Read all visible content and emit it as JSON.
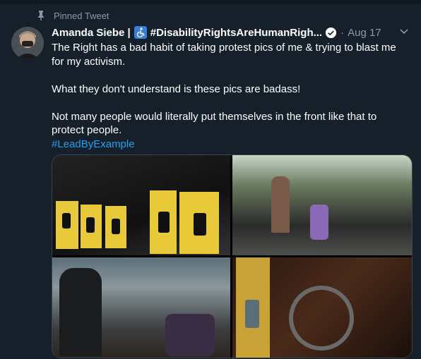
{
  "pinned": {
    "label": "Pinned Tweet"
  },
  "author": {
    "display_name": "Amanda Siebe |",
    "name_hashtag": "#DisabilityRightsAreHumanRigh...",
    "date": "Aug 17"
  },
  "tweet": {
    "line1": "The Right has a bad habit of taking protest pics of me & trying to blast me for my activism.",
    "line2": "What they don't understand is these pics are badass!",
    "line3": "Not many people would literally put themselves in the front like that to protect people.",
    "hashtag": "#LeadByExample"
  },
  "icons": {
    "pin": "pin-icon",
    "accessibility": "wheelchair-icon",
    "verified": "verified-badge-icon",
    "menu": "chevron-down-icon"
  },
  "colors": {
    "background": "#15202b",
    "secondary_text": "#8899a6",
    "link": "#1da1f2",
    "accessibility_badge": "#3b7ed6"
  }
}
